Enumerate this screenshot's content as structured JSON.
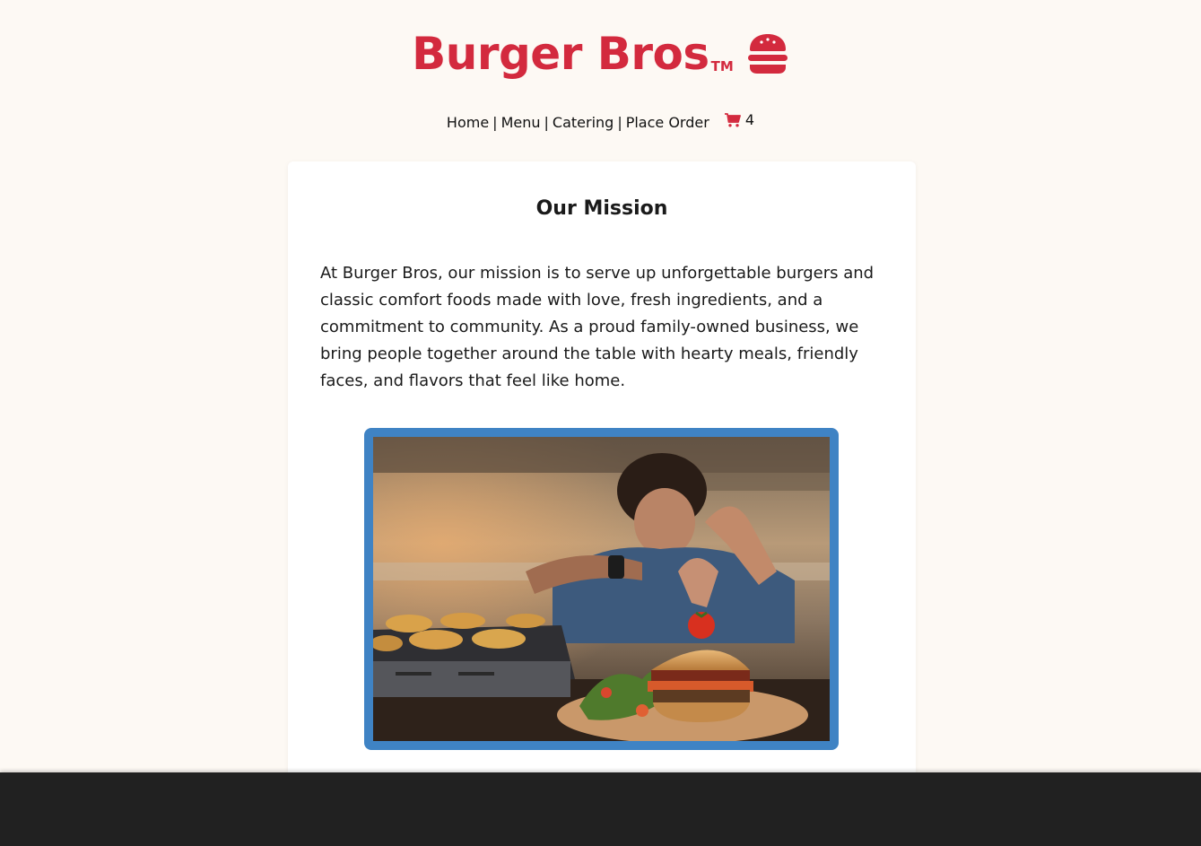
{
  "brand": {
    "title": "Burger Bros",
    "trademark": "TM",
    "icon": "burger-icon",
    "color": "#d32a3e"
  },
  "nav": {
    "items": [
      {
        "label": "Home"
      },
      {
        "label": "Menu"
      },
      {
        "label": "Catering"
      },
      {
        "label": "Place Order"
      }
    ],
    "separator": "|",
    "cart": {
      "icon": "cart-icon",
      "count": "4"
    }
  },
  "mission": {
    "heading": "Our Mission",
    "body": "At Burger Bros, our mission is to serve up unforgettable burgers and classic comfort foods made with love, fresh ingredients, and a commitment to community. As a proud family-owned business, we bring people together around the table with hearty meals, friendly faces, and flavors that feel like home."
  },
  "photo": {
    "frame_color": "#3f83c4"
  },
  "colors": {
    "background": "#fdf9f4",
    "card": "#ffffff",
    "footer": "#212121"
  }
}
